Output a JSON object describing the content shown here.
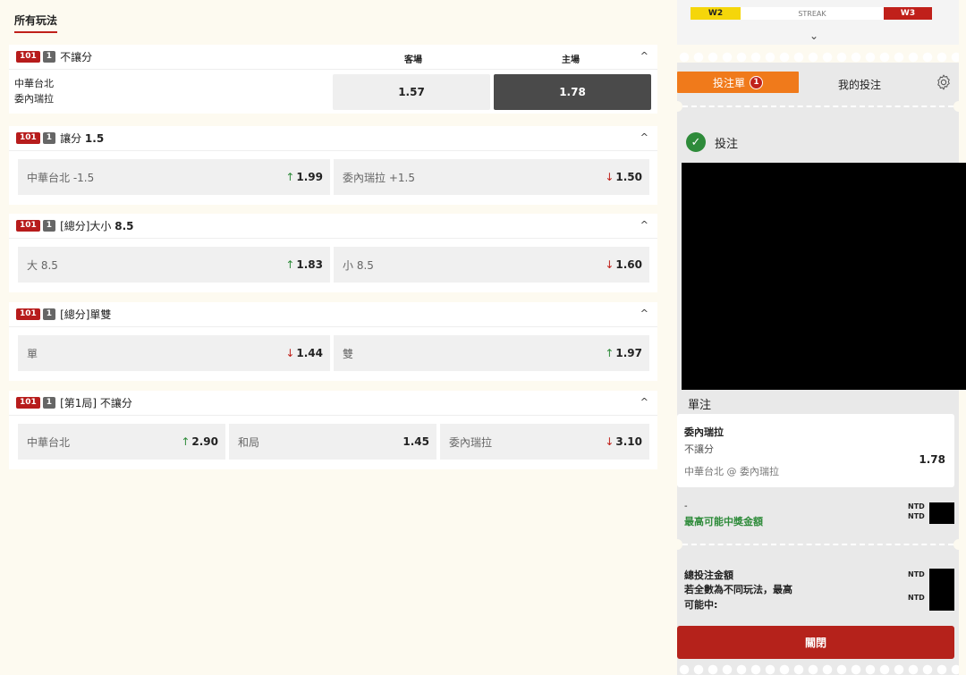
{
  "top_tab": "所有玩法",
  "markets": [
    {
      "id": "101",
      "num": "1",
      "title_plain": "不讓分",
      "title_bold": "",
      "col_away": "客場",
      "col_home": "主場",
      "teams": [
        "中華台北",
        "委內瑞拉"
      ],
      "odds": [
        {
          "value": "1.57",
          "selected": false
        },
        {
          "value": "1.78",
          "selected": true
        }
      ]
    },
    {
      "id": "101",
      "num": "1",
      "title_plain": "讓分",
      "title_bold": "1.5",
      "options": [
        {
          "label": "中華台北 -1.5",
          "value": "1.99",
          "trend": "↑"
        },
        {
          "label": "委內瑞拉 +1.5",
          "value": "1.50",
          "trend": "↓"
        }
      ]
    },
    {
      "id": "101",
      "num": "1",
      "title_plain": "[總分]大小",
      "title_bold": "8.5",
      "options": [
        {
          "label": "大 8.5",
          "value": "1.83",
          "trend": "↑"
        },
        {
          "label": "小 8.5",
          "value": "1.60",
          "trend": "↓"
        }
      ]
    },
    {
      "id": "101",
      "num": "1",
      "title_plain": "[總分]單雙",
      "title_bold": "",
      "options": [
        {
          "label": "單",
          "value": "1.44",
          "trend": "↓"
        },
        {
          "label": "雙",
          "value": "1.97",
          "trend": "↑"
        }
      ]
    },
    {
      "id": "101",
      "num": "1",
      "title_plain": "[第1局] 不讓分",
      "title_bold": "",
      "options": [
        {
          "label": "中華台北",
          "value": "2.90",
          "trend": "↑"
        },
        {
          "label": "和局",
          "value": "1.45",
          "trend": ""
        },
        {
          "label": "委內瑞拉",
          "value": "3.10",
          "trend": "↓"
        }
      ]
    }
  ],
  "stats": {
    "left_streak": "W2",
    "middle_label": "STREAK",
    "right_streak": "W3"
  },
  "betslip": {
    "tab_betslip": "投注單",
    "tab_count": "1",
    "tab_mybets": "我的投注",
    "bet_heading": "投注",
    "single_label": "單注",
    "selection": {
      "team": "委內瑞拉",
      "market": "不讓分",
      "match": "中華台北 @ 委內瑞拉",
      "odds": "1.78"
    },
    "dash": "-",
    "max_win_label": "最高可能中獎金額",
    "currency": "NTD",
    "total_stake_label": "總投注金額",
    "combo_label_1": "若全數為不同玩法，最高",
    "combo_label_2": "可能中:",
    "close_button": "關閉"
  },
  "colors": {
    "brand_red": "#b71c1c",
    "orange_tab": "#f07a1b",
    "up_green": "#2e8b3a",
    "down_red": "#c0201a",
    "selected_dark": "#4a4a4a"
  },
  "icons": {
    "collapse": "chevron-up-icon",
    "expand": "chevron-down-icon",
    "settings": "gear-icon",
    "confirm": "check-circle-icon"
  }
}
